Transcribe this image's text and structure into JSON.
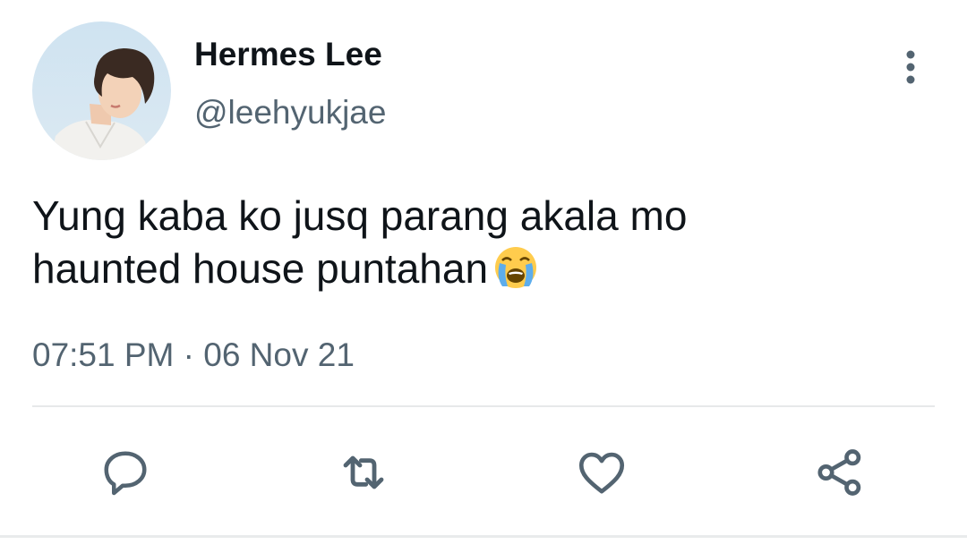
{
  "tweet": {
    "author": {
      "display_name": "Hermes Lee",
      "handle": "@leehyukjae"
    },
    "text_line1": "Yung kaba ko jusq parang akala mo",
    "text_line2": "haunted house puntahan",
    "emoji_icon": "loudly-crying-face-emoji",
    "timestamp": "07:51 PM · 06 Nov 21"
  },
  "actions": [
    {
      "name": "reply",
      "icon": "comment-icon"
    },
    {
      "name": "retweet",
      "icon": "retweet-icon"
    },
    {
      "name": "like",
      "icon": "heart-icon"
    },
    {
      "name": "share",
      "icon": "share-icon"
    }
  ],
  "colors": {
    "text_primary": "#0f1419",
    "text_secondary": "#536471",
    "icon": "#536471",
    "divider": "#e7e9ea"
  }
}
